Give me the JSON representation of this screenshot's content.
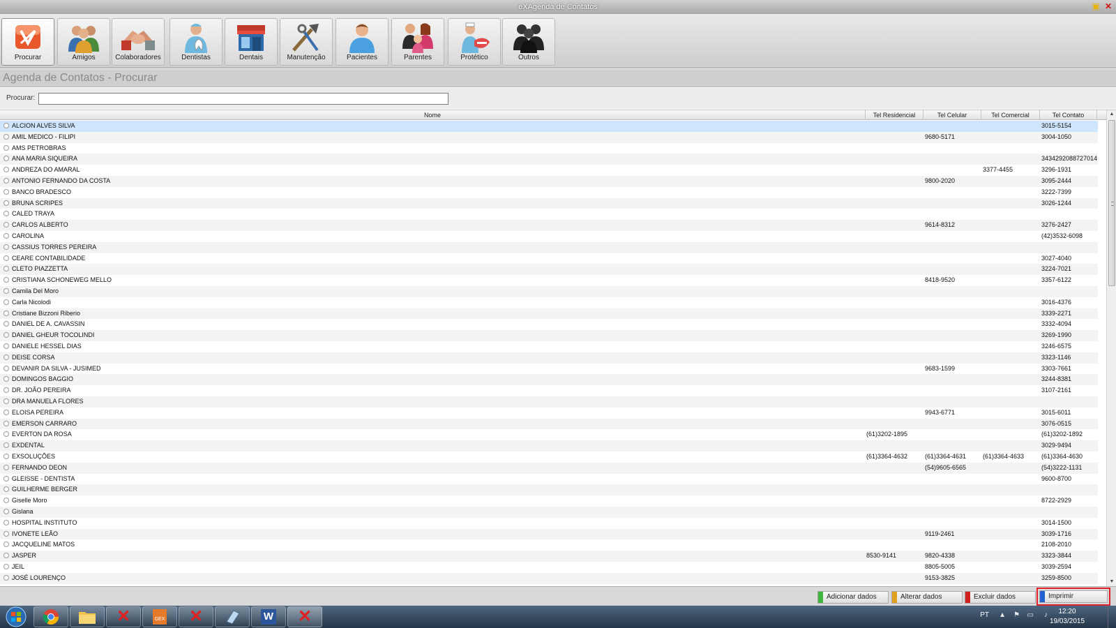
{
  "window": {
    "title": "eXAgenda de Contatos"
  },
  "toolbar": {
    "buttons": [
      {
        "label": "Procurar",
        "icon": "search-logo-icon"
      },
      {
        "label": "Amigos",
        "icon": "friends-icon"
      },
      {
        "label": "Colaboradores",
        "icon": "handshake-icon"
      },
      {
        "label": "Dentistas",
        "icon": "dentist-icon"
      },
      {
        "label": "Dentais",
        "icon": "dental-store-icon"
      },
      {
        "label": "Manutenção",
        "icon": "tools-icon"
      },
      {
        "label": "Pacientes",
        "icon": "patient-icon"
      },
      {
        "label": "Parentes",
        "icon": "family-icon"
      },
      {
        "label": "Protético",
        "icon": "prosthetist-icon"
      },
      {
        "label": "Outros",
        "icon": "others-icon"
      }
    ]
  },
  "section": {
    "title": "Agenda de Contatos - Procurar"
  },
  "search": {
    "label": "Procurar:",
    "value": ""
  },
  "grid": {
    "columns": {
      "nome": "Nome",
      "res": "Tel Residencial",
      "cel": "Tel Celular",
      "com": "Tel Comercial",
      "con": "Tel Contato"
    },
    "rows": [
      {
        "nome": "ALCION ALVES SILVA",
        "res": "",
        "cel": "",
        "com": "",
        "con": "3015-5154"
      },
      {
        "nome": "AMIL MEDICO - FILIPI",
        "res": "",
        "cel": "9680-5171",
        "com": "",
        "con": "3004-1050"
      },
      {
        "nome": "AMS PETROBRAS",
        "res": "",
        "cel": "",
        "com": "",
        "con": ""
      },
      {
        "nome": "ANA MARIA SIQUEIRA",
        "res": "",
        "cel": "",
        "com": "",
        "con": "3434292088727014"
      },
      {
        "nome": "ANDREZA DO AMARAL",
        "res": "",
        "cel": "",
        "com": "3377-4455",
        "con": "3296-1931"
      },
      {
        "nome": "ANTONIO FERNANDO DA COSTA",
        "res": "",
        "cel": "9800-2020",
        "com": "",
        "con": "3095-2444"
      },
      {
        "nome": "BANCO BRADESCO",
        "res": "",
        "cel": "",
        "com": "",
        "con": "3222-7399"
      },
      {
        "nome": "BRUNA SCRIPES",
        "res": "",
        "cel": "",
        "com": "",
        "con": "3026-1244"
      },
      {
        "nome": "CALED TRAYA",
        "res": "",
        "cel": "",
        "com": "",
        "con": ""
      },
      {
        "nome": "CARLOS ALBERTO",
        "res": "",
        "cel": "9614-8312",
        "com": "",
        "con": "3276-2427"
      },
      {
        "nome": "CAROLINA",
        "res": "",
        "cel": "",
        "com": "",
        "con": "(42)3532-6098"
      },
      {
        "nome": "CASSIUS TORRES PEREIRA",
        "res": "",
        "cel": "",
        "com": "",
        "con": ""
      },
      {
        "nome": "CEARE CONTABILIDADE",
        "res": "",
        "cel": "",
        "com": "",
        "con": "3027-4040"
      },
      {
        "nome": "CLETO PIAZZETTA",
        "res": "",
        "cel": "",
        "com": "",
        "con": "3224-7021"
      },
      {
        "nome": "CRISTIANA SCHONEWEG MELLO",
        "res": "",
        "cel": "8418-9520",
        "com": "",
        "con": "3357-6122"
      },
      {
        "nome": "Camila Del Moro",
        "res": "",
        "cel": "",
        "com": "",
        "con": ""
      },
      {
        "nome": "Carla Nicolodi",
        "res": "",
        "cel": "",
        "com": "",
        "con": "3016-4376"
      },
      {
        "nome": "Cristiane Bizzoni Riberio",
        "res": "",
        "cel": "",
        "com": "",
        "con": "3339-2271"
      },
      {
        "nome": "DANIEL DE A. CAVASSIN",
        "res": "",
        "cel": "",
        "com": "",
        "con": "3332-4094"
      },
      {
        "nome": "DANIEL GHEUR TOCOLINDI",
        "res": "",
        "cel": "",
        "com": "",
        "con": "3269-1990"
      },
      {
        "nome": "DANIELE HESSEL DIAS",
        "res": "",
        "cel": "",
        "com": "",
        "con": "3246-6575"
      },
      {
        "nome": "DEISE CORSA",
        "res": "",
        "cel": "",
        "com": "",
        "con": "3323-1146"
      },
      {
        "nome": "DEVANIR DA SILVA - JUSIMED",
        "res": "",
        "cel": "9683-1599",
        "com": "",
        "con": "3303-7661"
      },
      {
        "nome": "DOMINGOS BAGGIO",
        "res": "",
        "cel": "",
        "com": "",
        "con": "3244-8381"
      },
      {
        "nome": "DR. JOÃO PEREIRA",
        "res": "",
        "cel": "",
        "com": "",
        "con": "3107-2161"
      },
      {
        "nome": "DRA MANUELA FLORES",
        "res": "",
        "cel": "",
        "com": "",
        "con": ""
      },
      {
        "nome": "ELOISA PEREIRA",
        "res": "",
        "cel": "9943-6771",
        "com": "",
        "con": "3015-6011"
      },
      {
        "nome": "EMERSON CARRARO",
        "res": "",
        "cel": "",
        "com": "",
        "con": "3076-0515"
      },
      {
        "nome": "EVERTON DA ROSA",
        "res": "(61)3202-1895",
        "cel": "",
        "com": "",
        "con": "(61)3202-1892"
      },
      {
        "nome": "EXDENTAL",
        "res": "",
        "cel": "",
        "com": "",
        "con": "3029-9494"
      },
      {
        "nome": "EXSOLUÇÕES",
        "res": "(61)3364-4632",
        "cel": "(61)3364-4631",
        "com": "(61)3364-4633",
        "con": "(61)3364-4630"
      },
      {
        "nome": "FERNANDO DEON",
        "res": "",
        "cel": "(54)9605-6565",
        "com": "",
        "con": "(54)3222-1131"
      },
      {
        "nome": "GLEISSE - DENTISTA",
        "res": "",
        "cel": "",
        "com": "",
        "con": "9600-8700"
      },
      {
        "nome": "GUILHERME BERGER",
        "res": "",
        "cel": "",
        "com": "",
        "con": ""
      },
      {
        "nome": "Giselle Moro",
        "res": "",
        "cel": "",
        "com": "",
        "con": "8722-2929"
      },
      {
        "nome": "Gislana",
        "res": "",
        "cel": "",
        "com": "",
        "con": ""
      },
      {
        "nome": "HOSPITAL INSTITUTO",
        "res": "",
        "cel": "",
        "com": "",
        "con": "3014-1500"
      },
      {
        "nome": "IVONETE LEÃO",
        "res": "",
        "cel": "9119-2461",
        "com": "",
        "con": "3039-1716"
      },
      {
        "nome": "JACQUELINE MATOS",
        "res": "",
        "cel": "",
        "com": "",
        "con": "2108-2010"
      },
      {
        "nome": "JASPER",
        "res": "8530-9141",
        "cel": "9820-4338",
        "com": "",
        "con": "3323-3844"
      },
      {
        "nome": "JEIL",
        "res": "",
        "cel": "8805-5005",
        "com": "",
        "con": "3039-2594"
      },
      {
        "nome": "JOSÉ LOURENÇO",
        "res": "",
        "cel": "9153-3825",
        "com": "",
        "con": "3259-8500"
      }
    ]
  },
  "actions": {
    "add": "Adicionar dados",
    "edit": "Alterar dados",
    "delete": "Excluir dados",
    "print": "Imprimir",
    "colors": {
      "add": "#3fb53f",
      "edit": "#e0a020",
      "delete": "#d02020",
      "print": "#2060d0"
    }
  },
  "taskbar": {
    "language": "PT",
    "time": "12:20",
    "date": "19/03/2015",
    "apps": [
      "chrome-icon",
      "folder-icon",
      "red-x-app-icon",
      "gex-app-icon",
      "red-x-app-icon",
      "notepad-icon",
      "word-icon",
      "red-x-app-icon"
    ],
    "gex_label": "GEX",
    "word_label": "W"
  }
}
